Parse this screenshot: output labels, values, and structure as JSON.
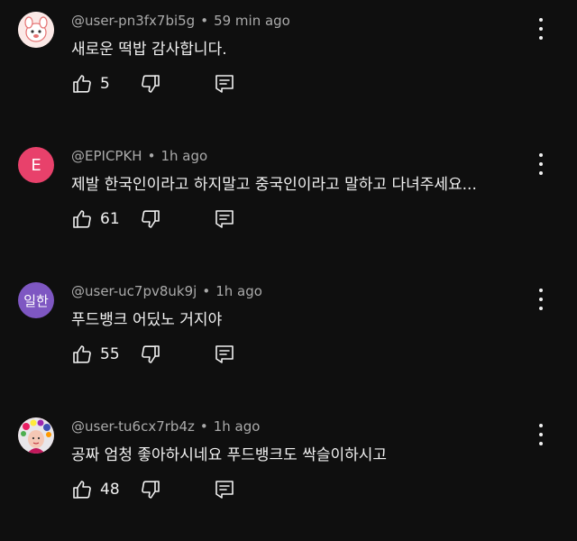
{
  "comments": [
    {
      "handle": "@user-pn3fx7bi5g",
      "time": "59 min ago",
      "text": "새로운 떡밥 감사합니다.",
      "likes": "5",
      "avatar": {
        "kind": "image",
        "bg": "#fbe9e7",
        "icon": "cartoon-character-avatar"
      }
    },
    {
      "handle": "@EPICPKH",
      "time": "1h ago",
      "text": "제발 한국인이라고 하지말고 중국인이라고 말하고 다녀주세요...",
      "likes": "61",
      "avatar": {
        "kind": "letter",
        "letter": "E",
        "bg": "#e8416b"
      }
    },
    {
      "handle": "@user-uc7pv8uk9j",
      "time": "1h ago",
      "text": "푸드뱅크 어딨노 거지야",
      "likes": "55",
      "avatar": {
        "kind": "letter",
        "letter": "일한",
        "bg": "#7e57c2"
      }
    },
    {
      "handle": "@user-tu6cx7rb4z",
      "time": "1h ago",
      "text": "공짜 엄청 좋아하시네요 푸드뱅크도 싹슬이하시고",
      "likes": "48",
      "avatar": {
        "kind": "image",
        "bg": "#d9a0a8",
        "icon": "photo-avatar"
      }
    }
  ],
  "colors": {
    "background": "#0f0f0f",
    "text": "#f1f1f1",
    "meta": "#aaaaaa"
  },
  "icons": {
    "like": "thumbs-up-icon",
    "dislike": "thumbs-down-icon",
    "reply": "reply-icon",
    "more": "more-vertical-icon"
  }
}
